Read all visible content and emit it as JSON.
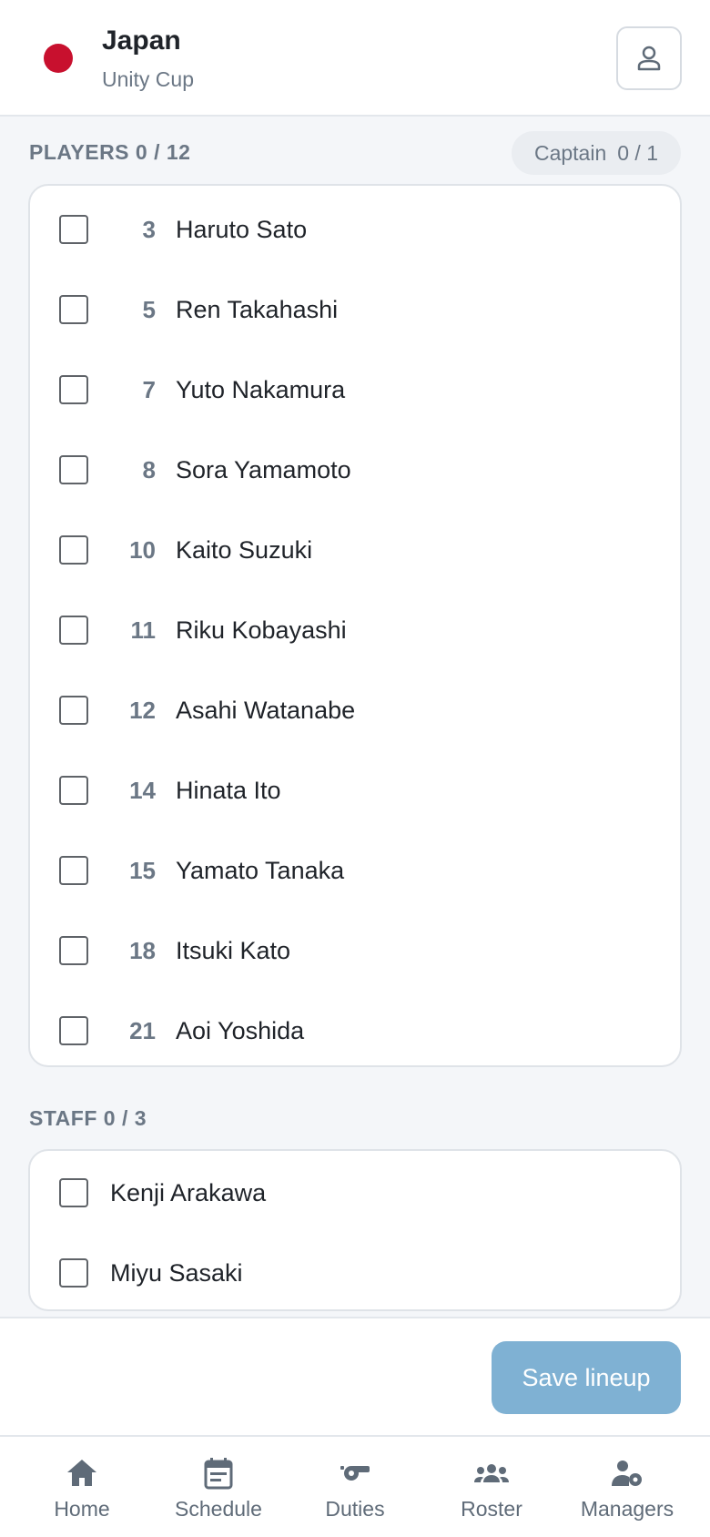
{
  "header": {
    "team_name": "Japan",
    "tournament": "Unity Cup",
    "flag_color": "#c8102e",
    "profile_icon": "person-icon"
  },
  "players_section": {
    "title": "PLAYERS 0 / 12",
    "captain_label": "Captain",
    "captain_count": "0 / 1",
    "players": [
      {
        "number": "3",
        "name": "Haruto Sato"
      },
      {
        "number": "5",
        "name": "Ren Takahashi"
      },
      {
        "number": "7",
        "name": "Yuto Nakamura"
      },
      {
        "number": "8",
        "name": "Sora Yamamoto"
      },
      {
        "number": "10",
        "name": "Kaito Suzuki"
      },
      {
        "number": "11",
        "name": "Riku Kobayashi"
      },
      {
        "number": "12",
        "name": "Asahi Watanabe"
      },
      {
        "number": "14",
        "name": "Hinata Ito"
      },
      {
        "number": "15",
        "name": "Yamato Tanaka"
      },
      {
        "number": "18",
        "name": "Itsuki Kato"
      },
      {
        "number": "21",
        "name": "Aoi Yoshida"
      }
    ]
  },
  "staff_section": {
    "title": "STAFF 0 / 3",
    "staff": [
      {
        "name": "Kenji Arakawa"
      },
      {
        "name": "Miyu Sasaki"
      }
    ]
  },
  "footer": {
    "save_label": "Save lineup",
    "save_color": "#7fb1d3"
  },
  "nav": {
    "items": [
      {
        "label": "Home",
        "icon": "home-icon"
      },
      {
        "label": "Schedule",
        "icon": "calendar-icon"
      },
      {
        "label": "Duties",
        "icon": "whistle-icon"
      },
      {
        "label": "Roster",
        "icon": "group-icon"
      },
      {
        "label": "Managers",
        "icon": "manager-settings-icon"
      }
    ]
  }
}
